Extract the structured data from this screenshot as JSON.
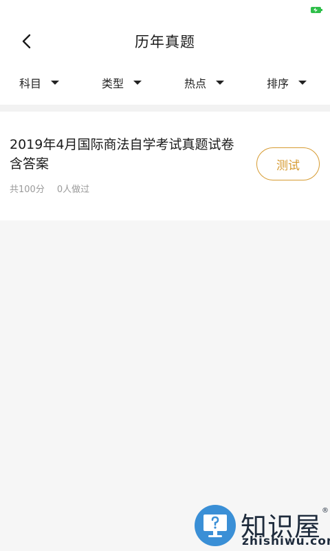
{
  "status_bar": {
    "battery_icon": "battery-charging-icon",
    "battery_color": "#2fbf4a"
  },
  "header": {
    "back_icon": "chevron-left-icon",
    "title": "历年真题"
  },
  "filters": [
    {
      "label": "科目",
      "icon": "caret-down-icon"
    },
    {
      "label": "类型",
      "icon": "caret-down-icon"
    },
    {
      "label": "热点",
      "icon": "caret-down-icon"
    },
    {
      "label": "排序",
      "icon": "caret-down-icon"
    }
  ],
  "exams": [
    {
      "title": "2019年4月国际商法自学考试真题试卷含答案",
      "total": "共100分",
      "participants": "0人做过",
      "action_label": "测试"
    }
  ],
  "watermark": {
    "brand": "知识屋",
    "registered": "®",
    "domain": "zhishiwu.com",
    "icon_color": "#3a8fd6"
  },
  "colors": {
    "accent": "#d69a30",
    "background": "#f6f6f6"
  }
}
